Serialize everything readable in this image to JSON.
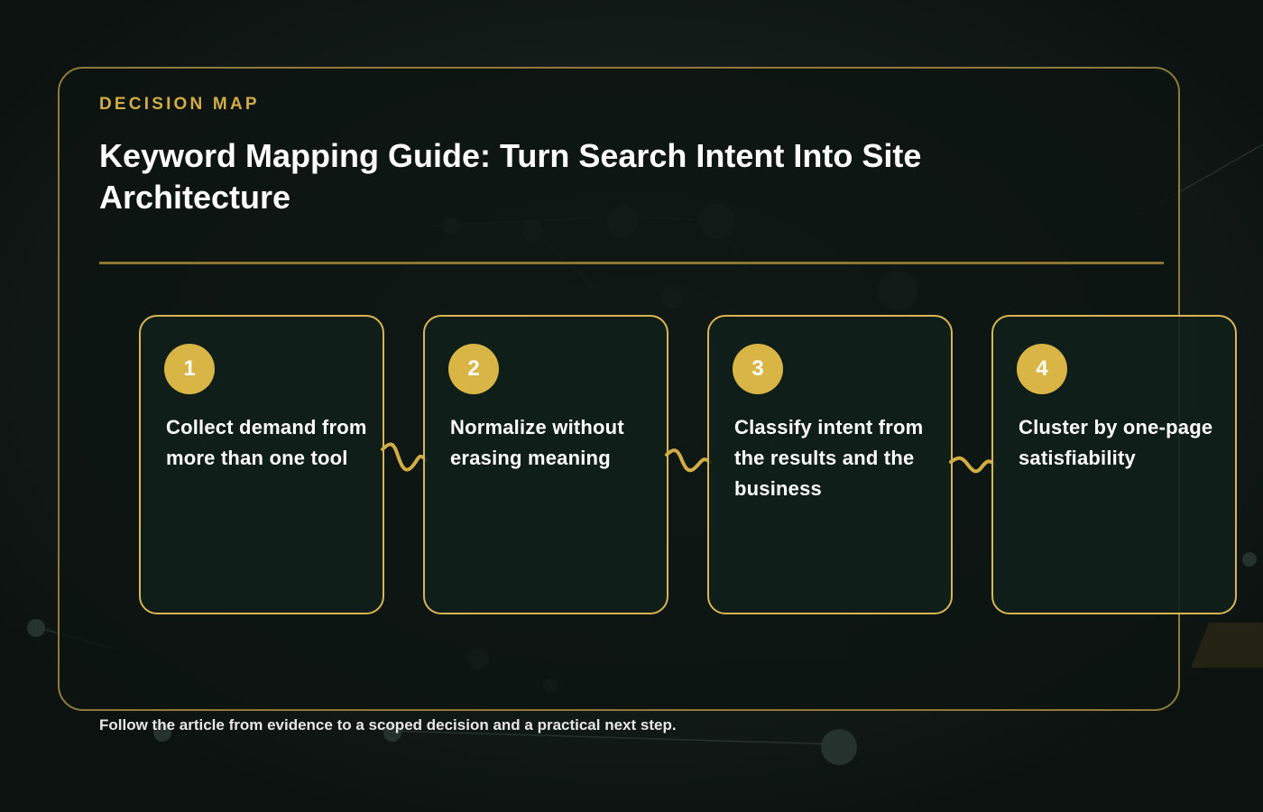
{
  "header": {
    "eyebrow": "DECISION MAP",
    "title": "Keyword Mapping Guide: Turn Search Intent Into Site Architecture"
  },
  "steps": [
    {
      "number": "1",
      "text": "Collect demand from more than one tool"
    },
    {
      "number": "2",
      "text": "Normalize without erasing meaning"
    },
    {
      "number": "3",
      "text": "Classify intent from the results and the business"
    },
    {
      "number": "4",
      "text": "Cluster by one-page satisfiability"
    }
  ],
  "footer": {
    "note": "Follow the article from evidence to a scoped decision and a practical next step."
  },
  "colors": {
    "accent": "#d9b545",
    "background": "#111916",
    "card": "#101f1b",
    "text": "#ffffff"
  }
}
